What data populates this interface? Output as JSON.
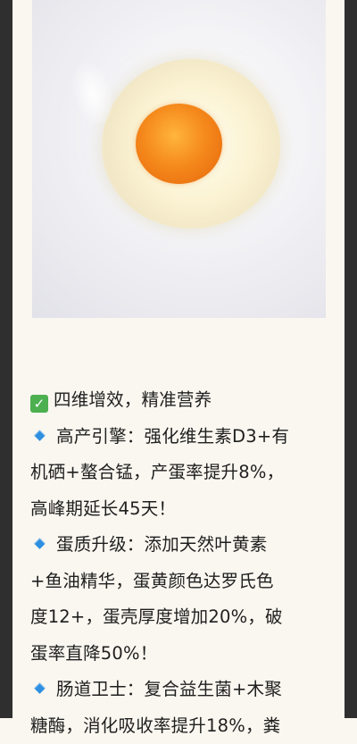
{
  "image": {
    "alt_icon": "raw-egg-photo"
  },
  "section": {
    "heading": "四维增效，精准营养",
    "items": [
      {
        "title": "高产引擎：强化维生素D3+有",
        "line2": "机硒+螯合锰，产蛋率提升8%，",
        "line3": "高峰期延长45天！"
      },
      {
        "title": "蛋质升级：添加天然叶黄素",
        "line2": "+鱼油精华，蛋黄颜色达罗氏色",
        "line3": "度12+，蛋壳厚度增加20%，破",
        "line4": "蛋率直降50%！"
      },
      {
        "title": "肠道卫士：复合益生菌+木聚",
        "line2": "糖酶，消化吸收率提升18%，粪"
      }
    ]
  }
}
